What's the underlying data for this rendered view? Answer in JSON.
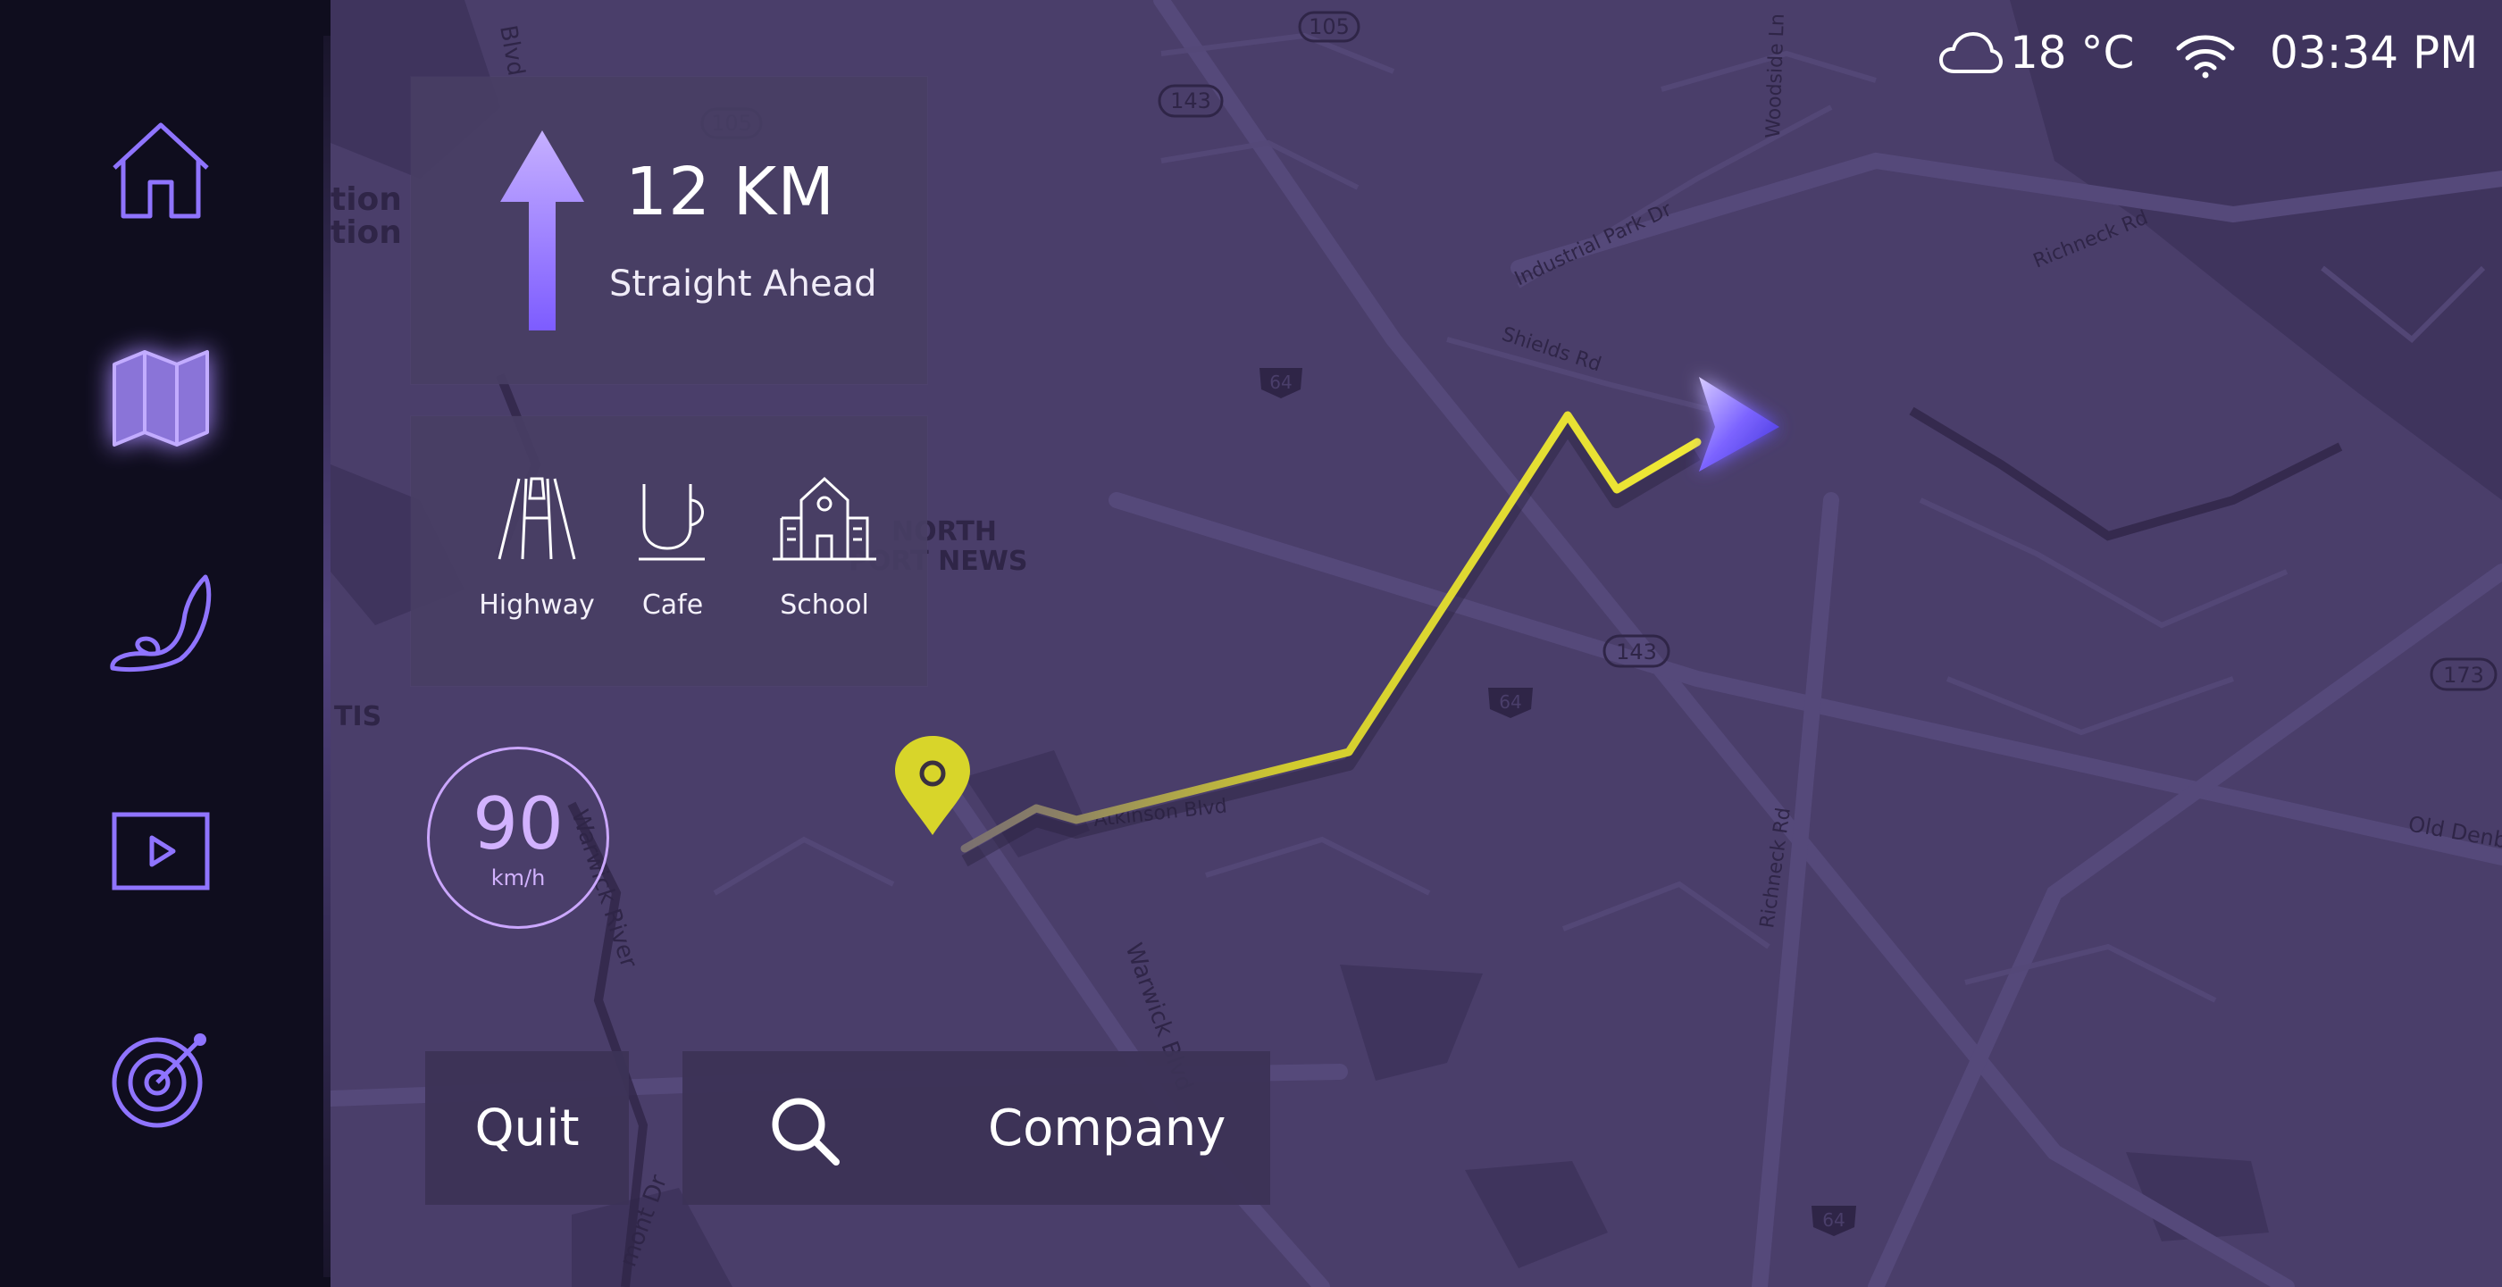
{
  "map_labels": {
    "road_1": "Industrial Park Dr",
    "road_2": "Shields Rd",
    "road_3": "Richneck Rd",
    "road_4": "Atkinson Blvd",
    "road_5": "Warwick River",
    "road_6": "Warwick Blvd",
    "road_7": "Richneck Rd",
    "road_8": "Old Denb",
    "road_9": "Woodside Ln",
    "road_10": "Blvd",
    "road_11": "mont Dr",
    "area_1": "NORTH",
    "area_2": "PORT NEWS",
    "area_3": "tion",
    "area_4": "tion",
    "area_5": "TIS",
    "shield_1": "105",
    "shield_2": "143",
    "shield_3": "105",
    "shield_4": "64",
    "shield_5": "143",
    "shield_6": "64",
    "shield_7": "173",
    "shield_8": "64"
  },
  "sidebar": {
    "items": [
      {
        "icon": "home-icon",
        "active": false
      },
      {
        "icon": "map-icon",
        "active": true
      },
      {
        "icon": "seat-icon",
        "active": false
      },
      {
        "icon": "video-icon",
        "active": false
      },
      {
        "icon": "music-icon",
        "active": false
      }
    ]
  },
  "navigation": {
    "distance": "12 KM",
    "instruction": "Straight Ahead",
    "arrow_icon": "arrow-up-icon"
  },
  "poi": [
    {
      "label": "Highway",
      "icon": "highway-icon"
    },
    {
      "label": "Cafe",
      "icon": "cafe-icon"
    },
    {
      "label": "School",
      "icon": "school-icon"
    }
  ],
  "speed": {
    "value": "90",
    "unit": "km/h"
  },
  "buttons": {
    "quit": "Quit",
    "destination": "Company"
  },
  "status": {
    "temperature": "18 °C",
    "time": "03:34 PM"
  },
  "colors": {
    "accent": "#9b7bff",
    "route": "#e6e032",
    "map_bg": "#4a3e6a",
    "sidebar_bg": "#0f0d1e"
  }
}
